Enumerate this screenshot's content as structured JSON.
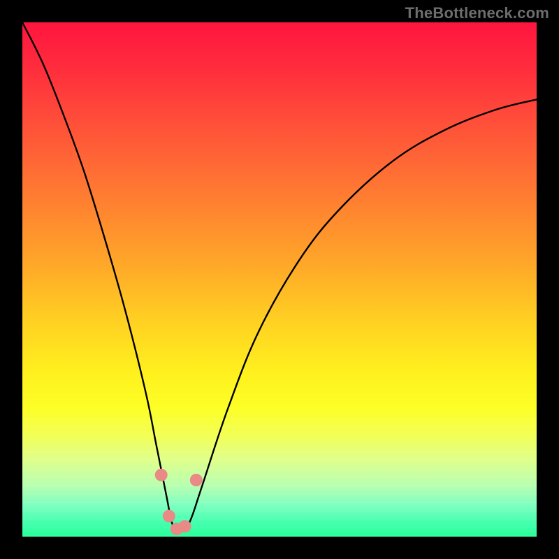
{
  "watermark": "TheBottleneck.com",
  "chart_data": {
    "type": "line",
    "title": "",
    "xlabel": "",
    "ylabel": "",
    "xlim": [
      0,
      100
    ],
    "ylim": [
      0,
      100
    ],
    "grid": false,
    "legend": false,
    "note": "V-shaped bottleneck curve; y≈100 at extremes, near 0 at the dip around x≈30.",
    "series": [
      {
        "name": "bottleneck-curve",
        "x": [
          0,
          4,
          8,
          12,
          16,
          20,
          24,
          26,
          28,
          29,
          30,
          31,
          32,
          33,
          35,
          40,
          46,
          54,
          62,
          72,
          82,
          92,
          100
        ],
        "y": [
          100,
          92,
          82,
          71,
          58,
          44,
          28,
          18,
          8,
          3,
          1,
          1,
          2,
          4,
          10,
          25,
          40,
          54,
          64,
          73,
          79,
          83,
          85
        ]
      }
    ],
    "markers": [
      {
        "name": "dot-left",
        "x": 27.0,
        "y": 12.0,
        "color": "#e98a86",
        "r": 9
      },
      {
        "name": "dot-mid1",
        "x": 28.5,
        "y": 4.0,
        "color": "#e98a86",
        "r": 9
      },
      {
        "name": "dot-mid2",
        "x": 30.0,
        "y": 1.5,
        "color": "#e98a86",
        "r": 9
      },
      {
        "name": "dot-mid3",
        "x": 31.6,
        "y": 2.0,
        "color": "#e98a86",
        "r": 9
      },
      {
        "name": "dot-right",
        "x": 33.8,
        "y": 11.0,
        "color": "#e98a86",
        "r": 9
      }
    ],
    "background_gradient": {
      "top": "#ff153e",
      "bottom": "#28ff9a"
    }
  }
}
